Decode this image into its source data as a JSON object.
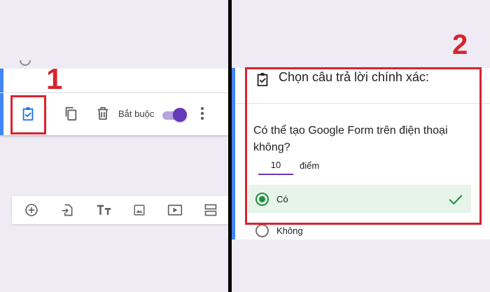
{
  "left_panel": {
    "step_number": "1",
    "toolbar": {
      "answer_key_icon": "assignment-check-icon",
      "duplicate_icon": "copy-icon",
      "delete_icon": "trash-icon",
      "required_label": "Bắt buộc",
      "required_toggle_on": true,
      "more_icon": "more-vert-icon"
    },
    "bottom_toolbar": {
      "icons": [
        "add-circle-icon",
        "import-icon",
        "title-icon",
        "image-icon",
        "video-icon",
        "section-icon"
      ]
    }
  },
  "right_panel": {
    "step_number": "2",
    "header_title": "Chọn câu trả lời chính xác:",
    "question": "Có thể tạo Google Form trên điện thoại không?",
    "points_value": "10",
    "points_label": "điểm",
    "options": [
      {
        "label": "Có",
        "selected": true,
        "correct": true
      },
      {
        "label": "Không",
        "selected": false,
        "correct": false
      }
    ]
  },
  "colors": {
    "accent_purple": "#673ab7",
    "highlight_red": "#d9232d",
    "correct_green": "#1e8e3e",
    "card_blue": "#4285f4",
    "background": "#efebf5"
  }
}
